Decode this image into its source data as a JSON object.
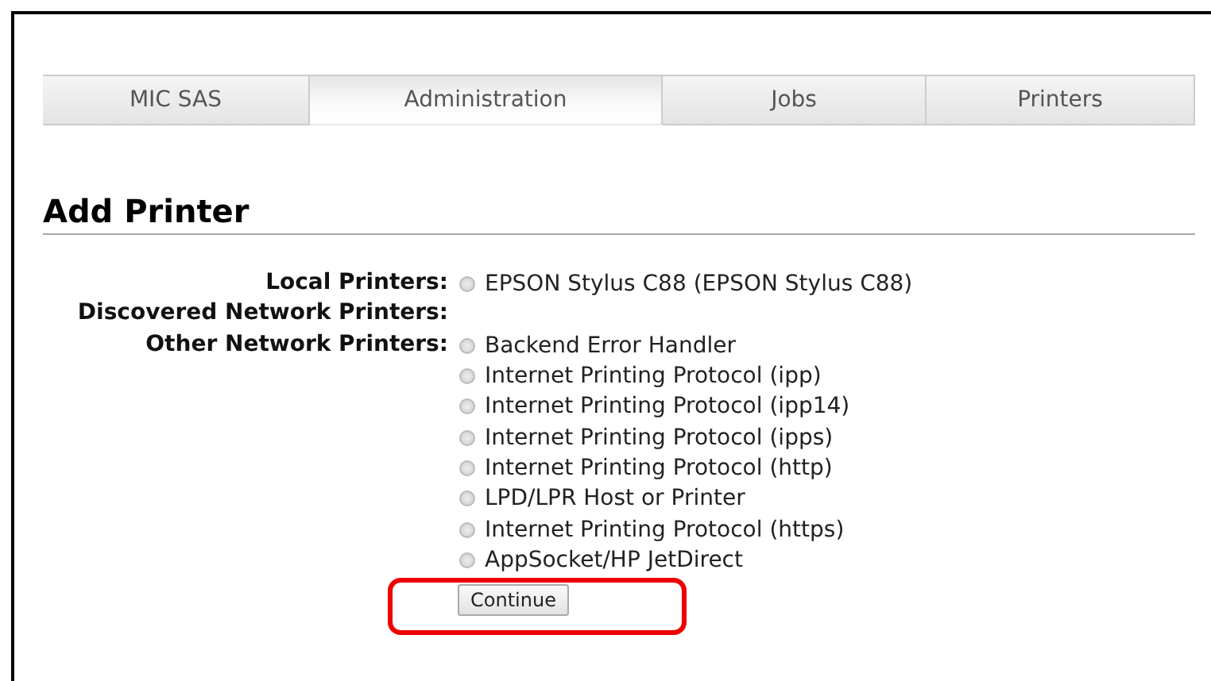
{
  "tabs": [
    {
      "label": "MIC SAS",
      "selected": false
    },
    {
      "label": "Administration",
      "selected": true
    },
    {
      "label": "Jobs",
      "selected": false
    },
    {
      "label": "Printers",
      "selected": false
    }
  ],
  "heading": "Add Printer",
  "groups": [
    {
      "label": "Local Printers:",
      "options": [
        {
          "label": "EPSON Stylus C88 (EPSON Stylus C88)",
          "selected": false
        }
      ]
    },
    {
      "label": "Discovered Network Printers:"
    },
    {
      "label": "Other Network Printers:",
      "options": [
        {
          "label": "Backend Error Handler",
          "selected": false
        },
        {
          "label": "Internet Printing Protocol (ipp)",
          "selected": false
        },
        {
          "label": "Internet Printing Protocol (ipp14)",
          "selected": false
        },
        {
          "label": "Internet Printing Protocol (ipps)",
          "selected": false
        },
        {
          "label": "Internet Printing Protocol (http)",
          "selected": false
        },
        {
          "label": "LPD/LPR Host or Printer",
          "selected": false
        },
        {
          "label": "Internet Printing Protocol (https)",
          "selected": false
        },
        {
          "label": "AppSocket/HP JetDirect",
          "selected": false
        }
      ]
    }
  ],
  "continue_button": {
    "label": "Continue",
    "highlighted": true
  }
}
